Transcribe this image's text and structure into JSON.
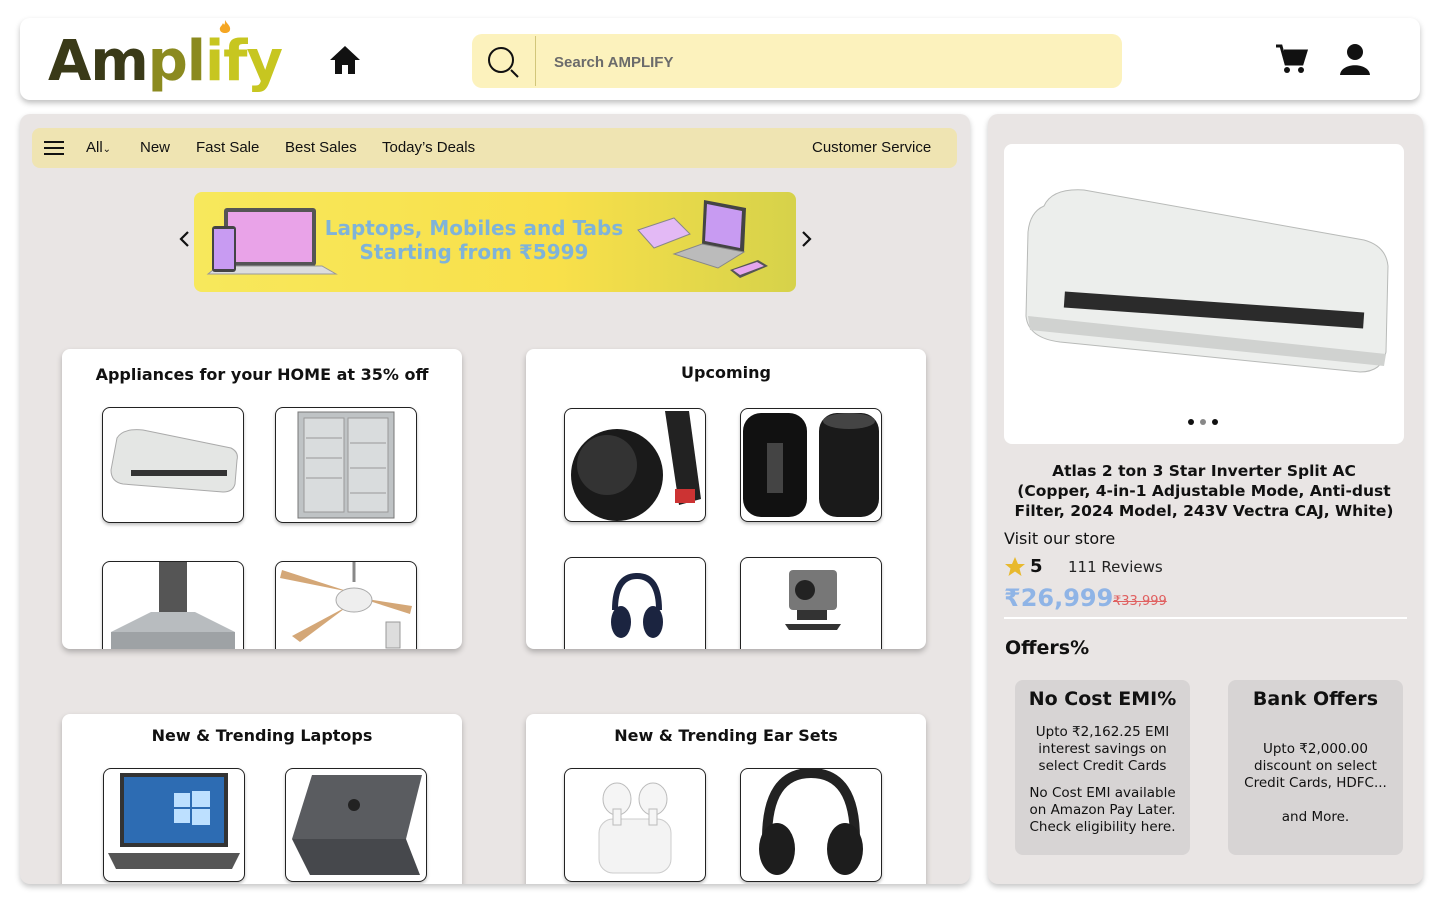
{
  "header": {
    "logo_text": "Amplify",
    "search_placeholder": "Search AMPLIFY"
  },
  "nav": {
    "all_label": "All",
    "items": [
      "New",
      "Fast Sale",
      "Best Sales",
      "Today’s Deals"
    ],
    "customer_service": "Customer Service"
  },
  "banner": {
    "line1": "Laptops, Mobiles and Tabs",
    "line2": "Starting from ₹5999"
  },
  "cards": [
    {
      "title": "Appliances for your HOME at 35% off",
      "items": [
        "air-conditioner",
        "refrigerator",
        "chimney",
        "ceiling-fan"
      ]
    },
    {
      "title": "Upcoming",
      "items": [
        "chromecast",
        "mac-pro",
        "headphones",
        "action-camera"
      ]
    },
    {
      "title": "New & Trending Laptops",
      "items": [
        "windows-laptop",
        "macbook"
      ]
    },
    {
      "title": "New & Trending Ear Sets",
      "items": [
        "airpods-pro",
        "over-ear-headphones"
      ]
    }
  ],
  "product": {
    "title_lines": [
      "Atlas 2 ton 3 Star Inverter Split AC",
      "(Copper, 4-in-1 Adjustable Mode, Anti-dust",
      "Filter, 2024 Model, 243V Vectra CAJ, White)"
    ],
    "visit_store": "Visit our store",
    "rating": "5",
    "reviews": "111 Reviews",
    "price": "₹26,999",
    "mrp": "₹33,999",
    "offers_title": "Offers%",
    "offers": [
      {
        "title": "No Cost EMI%",
        "body1": "Upto ₹2,162.25 EMI interest savings on select Credit Cards",
        "body2": "No Cost EMI available on Amazon Pay Later. Check eligibility here."
      },
      {
        "title": "Bank Offers",
        "body1": "Upto ₹2,000.00 discount on select Credit Cards, HDFC...",
        "body2": "and More."
      }
    ]
  },
  "colors": {
    "search_bg": "#fcf2bd",
    "nav_bg": "#efe4b2",
    "panel_bg": "#e9e5e4",
    "price": "#8fb4e6",
    "mrp": "#e06060",
    "logo_dark": "#3a3a18",
    "logo_light": "#c7c620"
  }
}
